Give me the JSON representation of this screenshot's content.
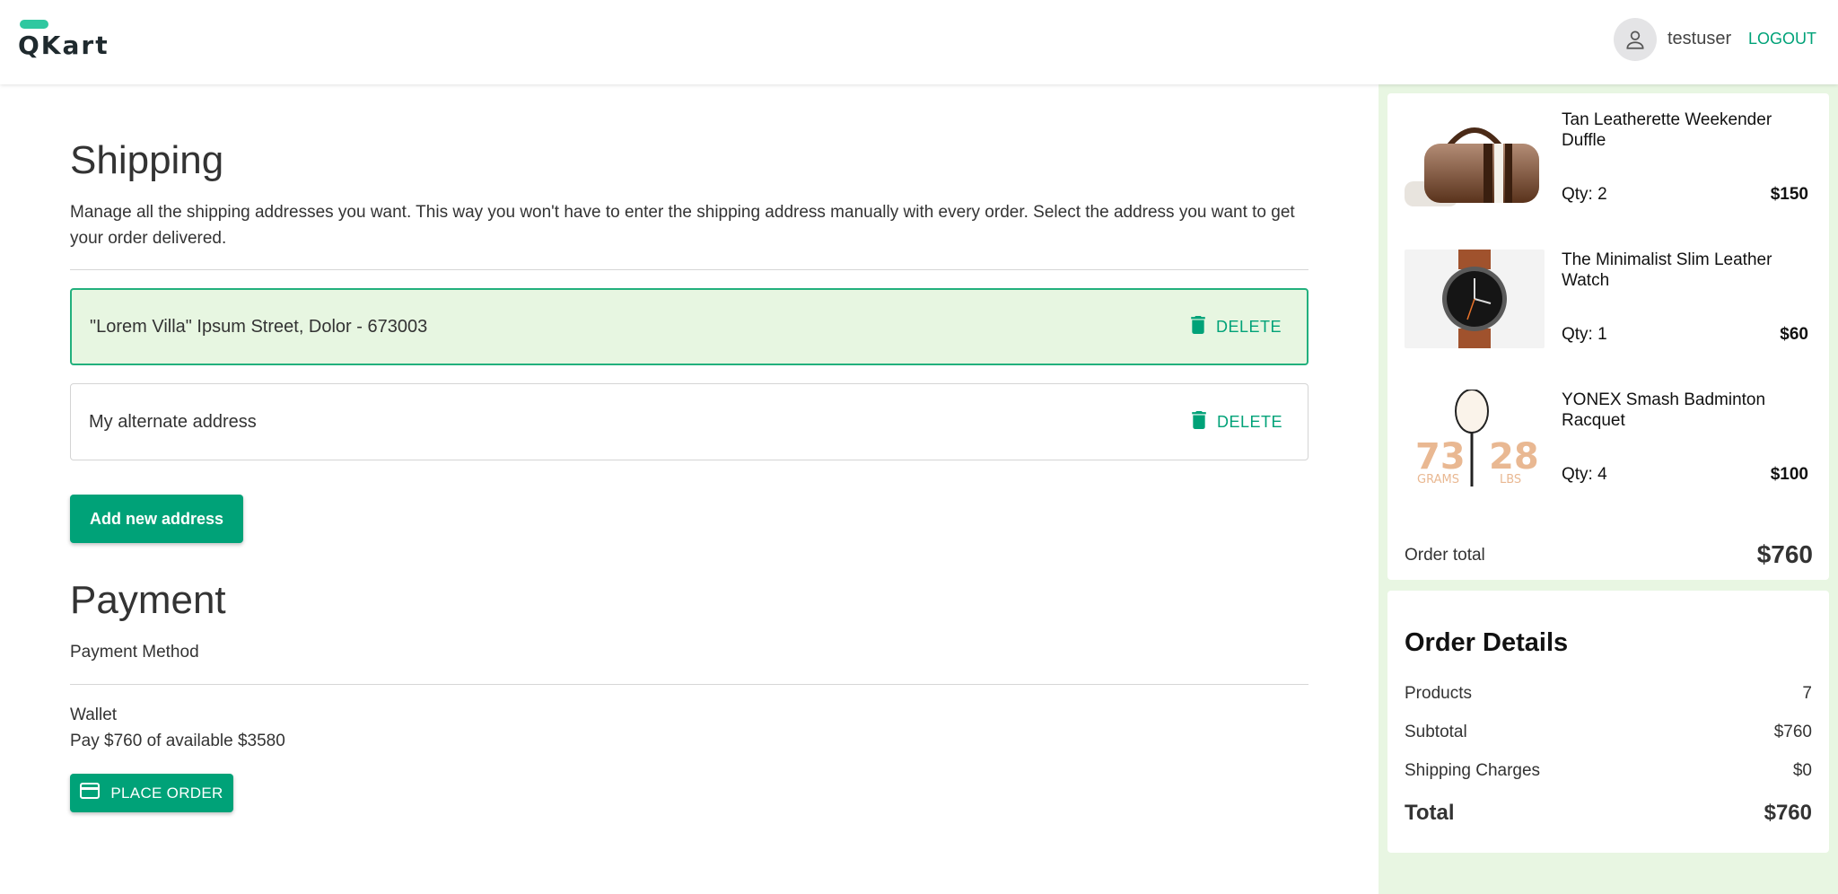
{
  "header": {
    "logo_text": "QKart",
    "username": "testuser",
    "logout_label": "LOGOUT"
  },
  "shipping": {
    "title": "Shipping",
    "description": "Manage all the shipping addresses you want. This way you won't have to enter the shipping address manually with every order. Select the address you want to get your order delivered.",
    "addresses": [
      {
        "text": "\"Lorem Villa\" Ipsum Street, Dolor - 673003",
        "selected": true,
        "delete_label": "DELETE"
      },
      {
        "text": "My alternate address",
        "selected": false,
        "delete_label": "DELETE"
      }
    ],
    "add_button_label": "Add new address"
  },
  "payment": {
    "title": "Payment",
    "method_label": "Payment Method",
    "wallet_label": "Wallet",
    "wallet_pay_text": "Pay $760 of available $3580",
    "place_order_label": "PLACE ORDER"
  },
  "cart": {
    "items": [
      {
        "name": "Tan Leatherette Weekender Duffle",
        "qty": "Qty: 2",
        "price": "$150",
        "icon": "duffle-bag-image"
      },
      {
        "name": "The Minimalist Slim Leather Watch",
        "qty": "Qty: 1",
        "price": "$60",
        "icon": "watch-image"
      },
      {
        "name": "YONEX Smash Badminton Racquet",
        "qty": "Qty: 4",
        "price": "$100",
        "icon": "racquet-image"
      }
    ],
    "order_total_label": "Order total",
    "order_total_value": "$760"
  },
  "order_details": {
    "title": "Order Details",
    "rows": [
      {
        "label": "Products",
        "value": "7"
      },
      {
        "label": "Subtotal",
        "value": "$760"
      },
      {
        "label": "Shipping Charges",
        "value": "$0"
      }
    ],
    "total_label": "Total",
    "total_value": "$760"
  },
  "colors": {
    "accent": "#00a278",
    "selected_bg": "#e7f6e1",
    "sidebar_bg": "#e8f6e2"
  }
}
